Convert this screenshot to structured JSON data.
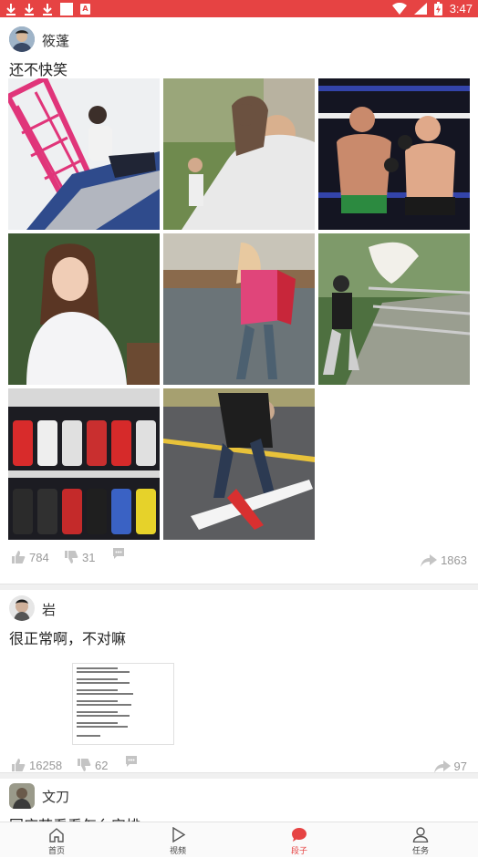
{
  "status_bar": {
    "time": "3:47",
    "battery_icon": "battery-charging-icon",
    "signal_icon": "signal-icon",
    "wifi_icon": "wifi-icon"
  },
  "posts": [
    {
      "username": "筱蓬",
      "text": "还不快笑",
      "images": [
        "gif-crane-worker",
        "gif-monkey-shoulder",
        "gif-boxing",
        "gif-girl-portrait",
        "gif-girl-umbrella",
        "gif-wind-sheet",
        "gif-vending-machine",
        "gif-rc-plane"
      ],
      "likes": "784",
      "dislikes": "31",
      "comments": "",
      "shares": "1863"
    },
    {
      "username": "岩",
      "text": "很正常啊，不对嘛",
      "image": "text-screenshot",
      "likes": "16258",
      "dislikes": "62",
      "comments": "",
      "shares": "97"
    },
    {
      "username": "文刀",
      "text": "国庆节看看怎么安排"
    }
  ],
  "tabs": [
    {
      "label": "首页",
      "icon": "home-icon"
    },
    {
      "label": "视频",
      "icon": "play-icon"
    },
    {
      "label": "段子",
      "icon": "chat-bubble-icon"
    },
    {
      "label": "任务",
      "icon": "user-icon"
    }
  ],
  "colors": {
    "accent": "#e64343",
    "divider": "#f0f0f0",
    "icon_gray": "#bbbbbb"
  }
}
